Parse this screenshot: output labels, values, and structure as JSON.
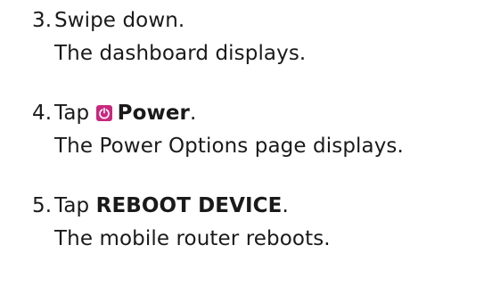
{
  "steps": [
    {
      "number": "3.",
      "action_prefix": "Swipe down.",
      "result": "The dashboard displays."
    },
    {
      "number": "4.",
      "action_prefix": "Tap ",
      "icon": "power-icon",
      "bold_label": "Power",
      "action_suffix": ".",
      "result": "The Power Options page displays."
    },
    {
      "number": "5.",
      "action_prefix": "Tap ",
      "bold_label": "REBOOT DEVICE",
      "action_suffix": ".",
      "result": "The mobile router reboots."
    }
  ],
  "colors": {
    "text": "#1a1a1a",
    "icon_background": "#c8287e"
  }
}
